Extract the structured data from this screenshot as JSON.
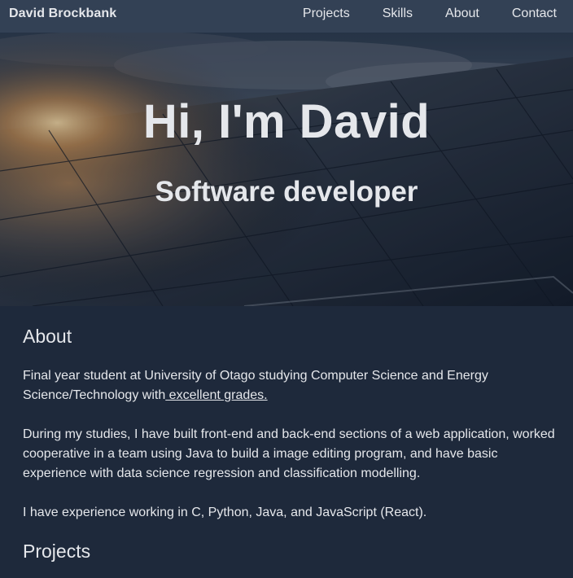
{
  "nav": {
    "brand": "David Brockbank",
    "links": [
      "Projects",
      "Skills",
      "About",
      "Contact"
    ]
  },
  "hero": {
    "title": "Hi, I'm David",
    "subtitle": "Software developer"
  },
  "about": {
    "heading": "About",
    "p1_text": "Final year student at University of Otago studying Computer Science and Energy Science/Technology with",
    "p1_link": " excellent grades.",
    "p2": "During my studies, I have built front-end and back-end sections of a web application, worked cooperative in a team using Java to build a image editing program, and have basic experience with data science regression and classification modelling.",
    "p3": "I have experience working in C, Python, Java, and JavaScript (React)."
  },
  "projects": {
    "heading": "Projects"
  },
  "colors": {
    "navbar": "#334155",
    "background": "#1e293b",
    "text": "#e5e7eb"
  }
}
